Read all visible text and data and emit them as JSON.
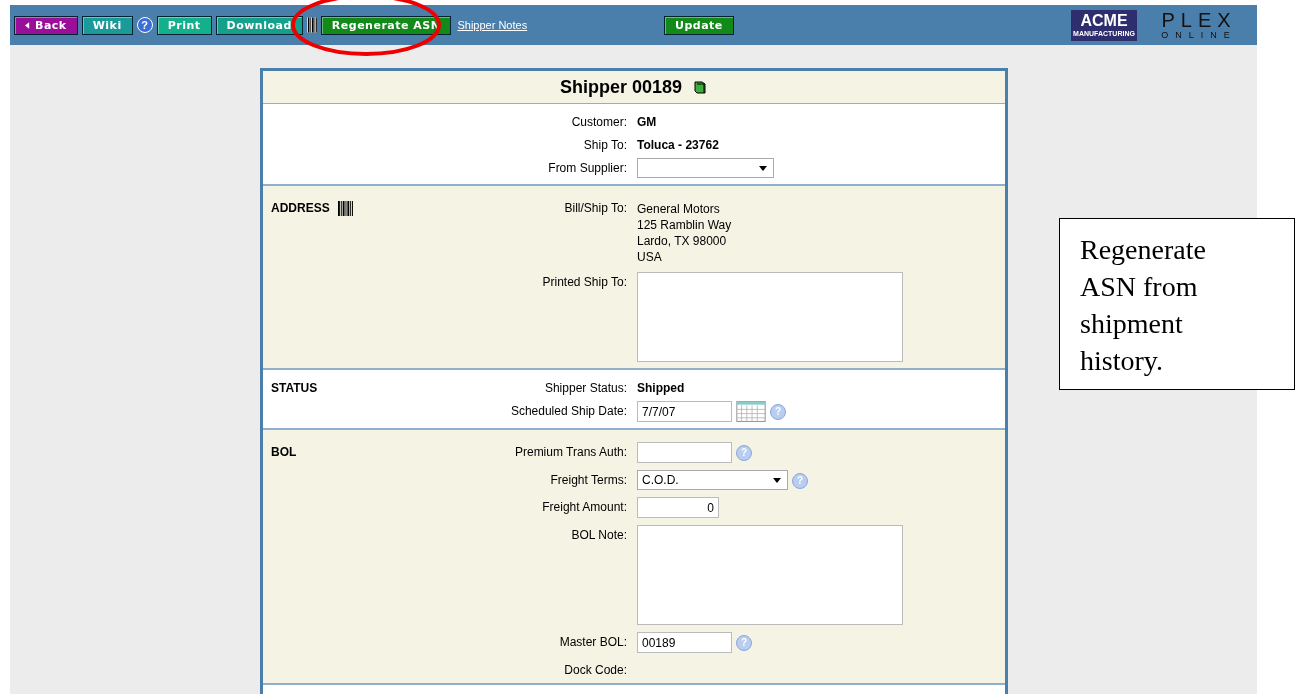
{
  "toolbar": {
    "items": [
      {
        "kind": "back",
        "label": "Back",
        "color": "#9a0f9a"
      },
      {
        "kind": "button",
        "label": "Wiki",
        "color": "#1a9a9a"
      },
      {
        "kind": "help",
        "label": "?"
      },
      {
        "kind": "button",
        "label": "Print",
        "color": "#14b08c"
      },
      {
        "kind": "button",
        "label": "Download",
        "color": "#14a08a"
      },
      {
        "kind": "barcode"
      },
      {
        "kind": "button",
        "label": "Regenerate ASN",
        "color": "#128a1a"
      },
      {
        "kind": "link",
        "label": "Shipper Notes"
      }
    ],
    "update": {
      "label": "Update",
      "color": "#128a1a"
    },
    "logos": {
      "acme": "ACME",
      "acme_sub": "MANUFACTURING",
      "plex": "PLEX",
      "plex_sub": "ONLINE"
    }
  },
  "form": {
    "title": "Shipper 00189",
    "sections": [
      {
        "fields": [
          {
            "label": "Customer:",
            "kind": "text",
            "value": "GM"
          },
          {
            "label": "Ship To:",
            "kind": "text",
            "value": "Toluca - 23762"
          },
          {
            "label": "From Supplier:",
            "kind": "select"
          }
        ]
      },
      {
        "heading": "ADDRESS",
        "barcode": true,
        "fields": [
          {
            "label": "Bill/Ship To:",
            "kind": "lines",
            "lines": [
              "General Motors",
              "125 Ramblin Way",
              "Lardo, TX 98000",
              "USA"
            ]
          },
          {
            "label": "Printed Ship To:",
            "kind": "textarea"
          }
        ]
      },
      {
        "heading": "STATUS",
        "fields": [
          {
            "label": "Shipper Status:",
            "kind": "text",
            "value": "Shipped"
          },
          {
            "label": "Scheduled Ship Date:",
            "kind": "input",
            "value": "7/7/07",
            "calendar": true,
            "help": "?"
          }
        ]
      },
      {
        "heading": "BOL",
        "fields": [
          {
            "label": "Premium Trans Auth:",
            "kind": "input",
            "help": "?"
          },
          {
            "label": "Freight Terms:",
            "kind": "select",
            "value": "C.O.D.",
            "help": "?"
          },
          {
            "label": "Freight Amount:",
            "kind": "number",
            "value": "0"
          },
          {
            "label": "BOL Note:",
            "kind": "textarea"
          },
          {
            "label": "Master BOL:",
            "kind": "input",
            "value": "00189",
            "help": "?"
          },
          {
            "label": "Dock Code:",
            "kind": "none"
          }
        ]
      }
    ]
  },
  "annotation": {
    "callout": "Regenerate ASN from shipment history."
  }
}
